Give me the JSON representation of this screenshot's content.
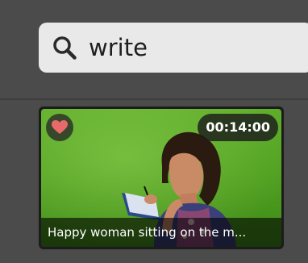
{
  "search": {
    "value": "write",
    "icon": "search-icon"
  },
  "results": [
    {
      "duration": "00:14:00",
      "title": "Happy woman sitting on the m...",
      "favorite": true,
      "favorite_icon": "heart-icon",
      "favorite_color": "#e86a6a"
    }
  ],
  "colors": {
    "background": "#4b4b4b",
    "search_bg": "#e9e9e9"
  }
}
